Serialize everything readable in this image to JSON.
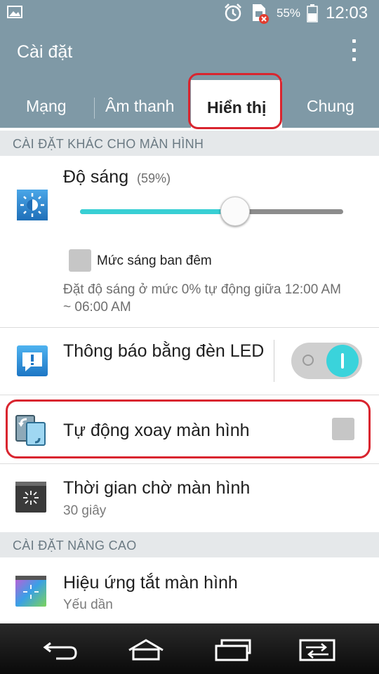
{
  "status_bar": {
    "battery_percent": "55%",
    "time": "12:03",
    "icons": [
      "gallery-icon",
      "alarm-icon",
      "sim-error-icon",
      "battery-icon"
    ]
  },
  "app_bar": {
    "title": "Cài đặt",
    "overflow_icon": "more-vert-icon"
  },
  "tabs": [
    {
      "label": "Mạng",
      "active": false
    },
    {
      "label": "Âm thanh",
      "active": false
    },
    {
      "label": "Hiển thị",
      "active": true
    },
    {
      "label": "Chung",
      "active": false
    }
  ],
  "sections": {
    "other_display": "CÀI ĐẶT KHÁC CHO MÀN HÌNH",
    "advanced": "CÀI ĐẶT NÂNG CAO"
  },
  "brightness": {
    "title": "Độ sáng",
    "value_label": "(59%)",
    "value": 0.59,
    "night_checkbox_label": "Mức sáng ban đêm",
    "night_checked": false,
    "night_description": "Đặt độ sáng ở mức 0% tự động giữa 12:00 AM ~ 06:00 AM"
  },
  "led_notification": {
    "title": "Thông báo bằng đèn LED",
    "enabled": true
  },
  "auto_rotate": {
    "title": "Tự động xoay màn hình",
    "checked": false
  },
  "screen_timeout": {
    "title": "Thời gian chờ màn hình",
    "subtitle": "30 giây"
  },
  "screen_off_effect": {
    "title": "Hiệu ứng tắt màn hình",
    "subtitle": "Yếu dần"
  },
  "nav_bar": {
    "buttons": [
      "back-icon",
      "home-icon",
      "recent-apps-icon",
      "dual-window-icon"
    ]
  },
  "colors": {
    "accent": "#38cfd4",
    "header": "#7f99a6",
    "highlight": "#d9252f"
  }
}
